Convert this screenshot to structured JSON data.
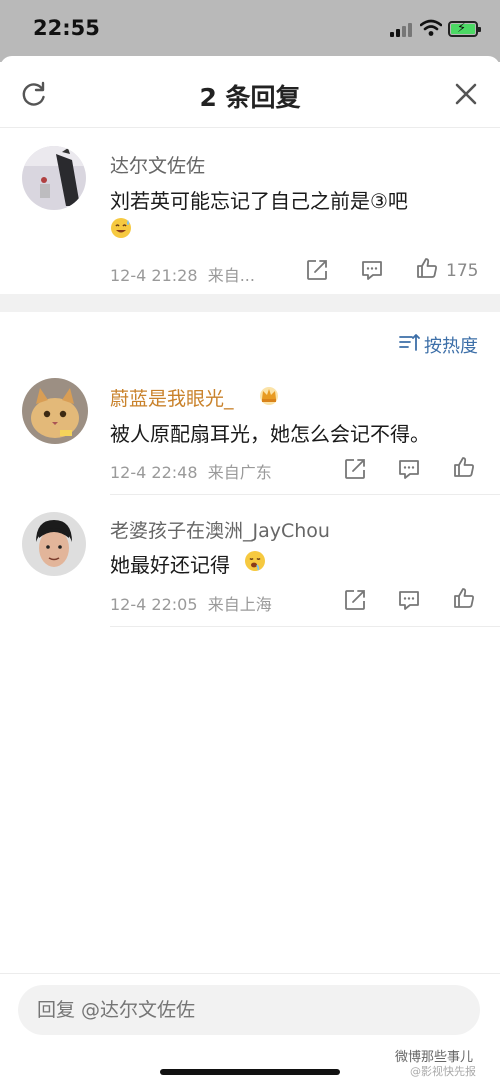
{
  "status_bar": {
    "time": "22:55"
  },
  "header": {
    "title": "2 条回复",
    "refresh_icon": "refresh-icon",
    "close_icon": "close-icon"
  },
  "root_comment": {
    "username": "达尔文佐佐",
    "text": "刘若英可能忘记了自己之前是③吧",
    "emoji": "sweat-smile-emoji",
    "time": "12-4 21:28",
    "location": "来自...",
    "like_count": "175"
  },
  "sort": {
    "label": "按热度",
    "icon": "sort-icon"
  },
  "replies": [
    {
      "username": "蔚蓝是我眼光_",
      "username_color": "#c9822b",
      "badge_icon": "crown-icon",
      "text": "被人原配扇耳光，她怎么会记不得。",
      "time": "12-4 22:48",
      "location": "来自广东"
    },
    {
      "username": "老婆孩子在澳洲_JayChou",
      "username_color": "#666666",
      "text": "她最好还记得",
      "emoji": "drooling-emoji",
      "time": "12-4 22:05",
      "location": "来自上海"
    }
  ],
  "reply_box": {
    "placeholder": "回复 @达尔文佐佐"
  },
  "watermark": {
    "line1": "微博那些事儿",
    "line2": "@影视快先报"
  },
  "colors": {
    "link_blue": "#3d6fa8",
    "highlight_name": "#c9822b"
  }
}
